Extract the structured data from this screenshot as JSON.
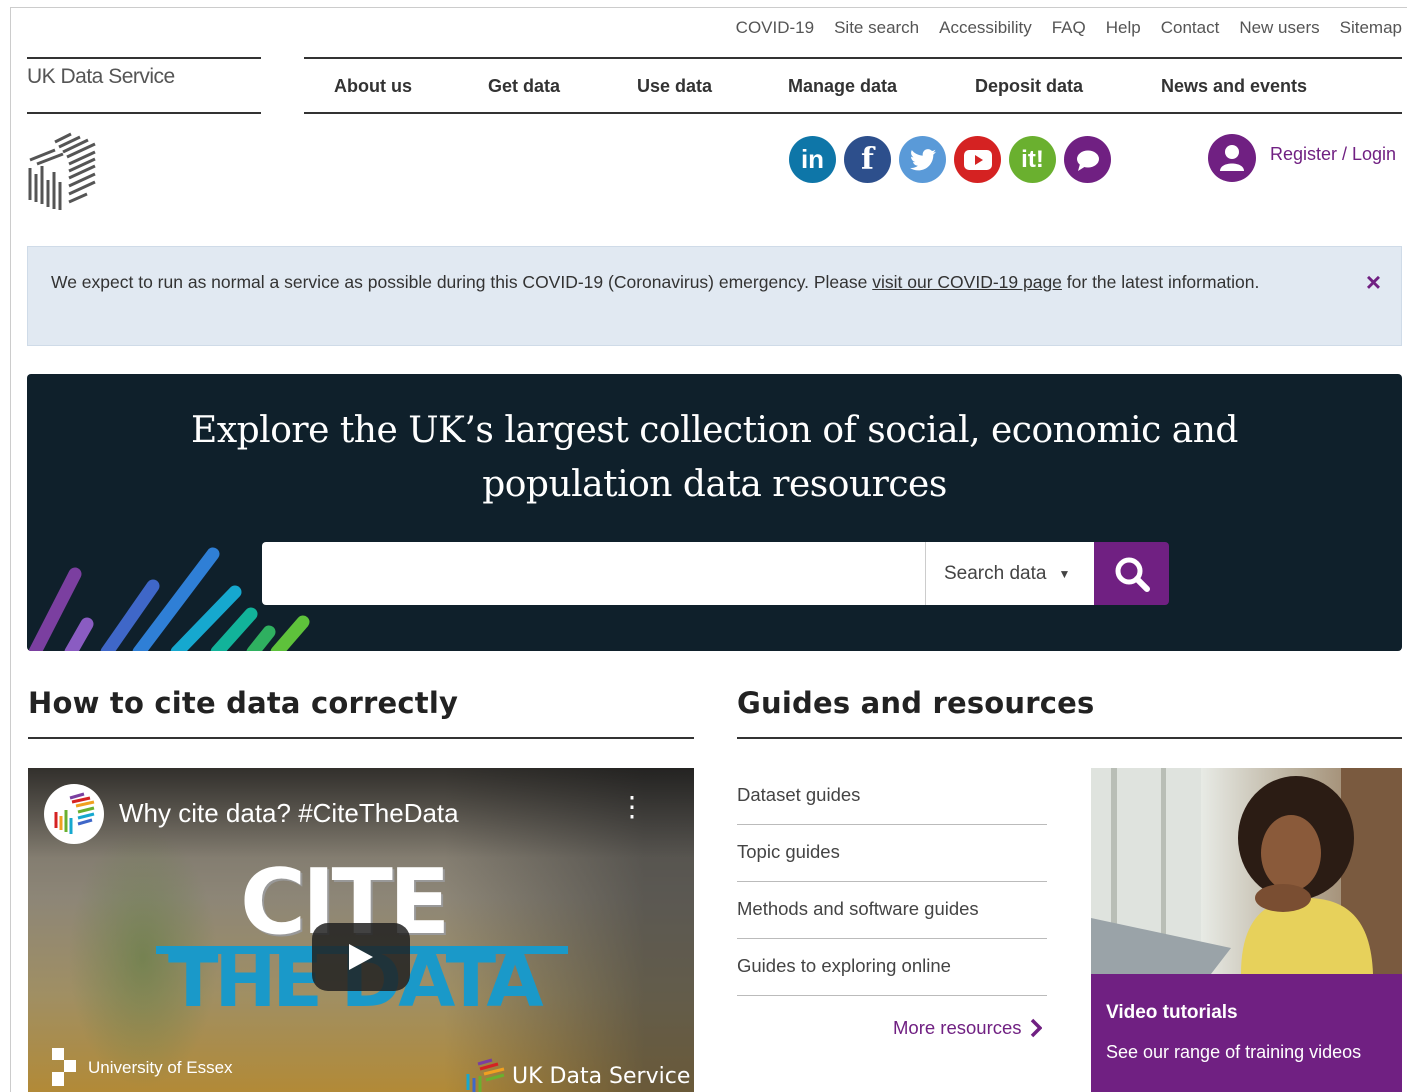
{
  "utility_nav": [
    "COVID-19",
    "Site search",
    "Accessibility",
    "FAQ",
    "Help",
    "Contact",
    "New users",
    "Sitemap"
  ],
  "logo": {
    "text": "UK Data Service"
  },
  "main_nav": [
    "About us",
    "Get data",
    "Use data",
    "Manage data",
    "Deposit data",
    "News and events"
  ],
  "social": [
    {
      "icon": "linkedin-icon",
      "glyph": "in",
      "color": "#0e76a8"
    },
    {
      "icon": "facebook-icon",
      "glyph": "f",
      "color": "#2d4f8c"
    },
    {
      "icon": "twitter-icon",
      "glyph": "t",
      "color": "#5a9ad8"
    },
    {
      "icon": "youtube-icon",
      "glyph": "▶",
      "color": "#d52222"
    },
    {
      "icon": "jiscmail-icon",
      "glyph": "it!",
      "color": "#6ab02f"
    },
    {
      "icon": "chat-icon",
      "glyph": "…",
      "color": "#702082"
    }
  ],
  "login": {
    "label": "Register / Login"
  },
  "alert": {
    "text_before": "We expect to run as normal a service as possible during this COVID-19 (Coronavirus) emergency. Please ",
    "link": "visit our COVID-19 page",
    "text_after": " for the latest information.",
    "close": "×"
  },
  "hero": {
    "title": "Explore the UK’s largest collection of social, economic and population data resources",
    "search_placeholder": "",
    "search_scope": "Search data"
  },
  "cite_section": {
    "title": "How to cite data correctly",
    "video": {
      "title": "Why cite data? #CiteTheData",
      "big_text_1": "CITE",
      "big_text_2": "THE DATA",
      "footer_left": "University of Essex",
      "footer_right": "UK Data Service"
    }
  },
  "guides_section": {
    "title": "Guides and resources",
    "items": [
      "Dataset guides",
      "Topic guides",
      "Methods and software guides",
      "Guides to exploring online"
    ],
    "more": "More resources",
    "card": {
      "title": "Video tutorials",
      "subtitle": "See our range of training videos"
    }
  },
  "colors": {
    "brand": "#702082",
    "hero_bg": "#0f202b",
    "alert_bg": "#e1e9f2"
  }
}
